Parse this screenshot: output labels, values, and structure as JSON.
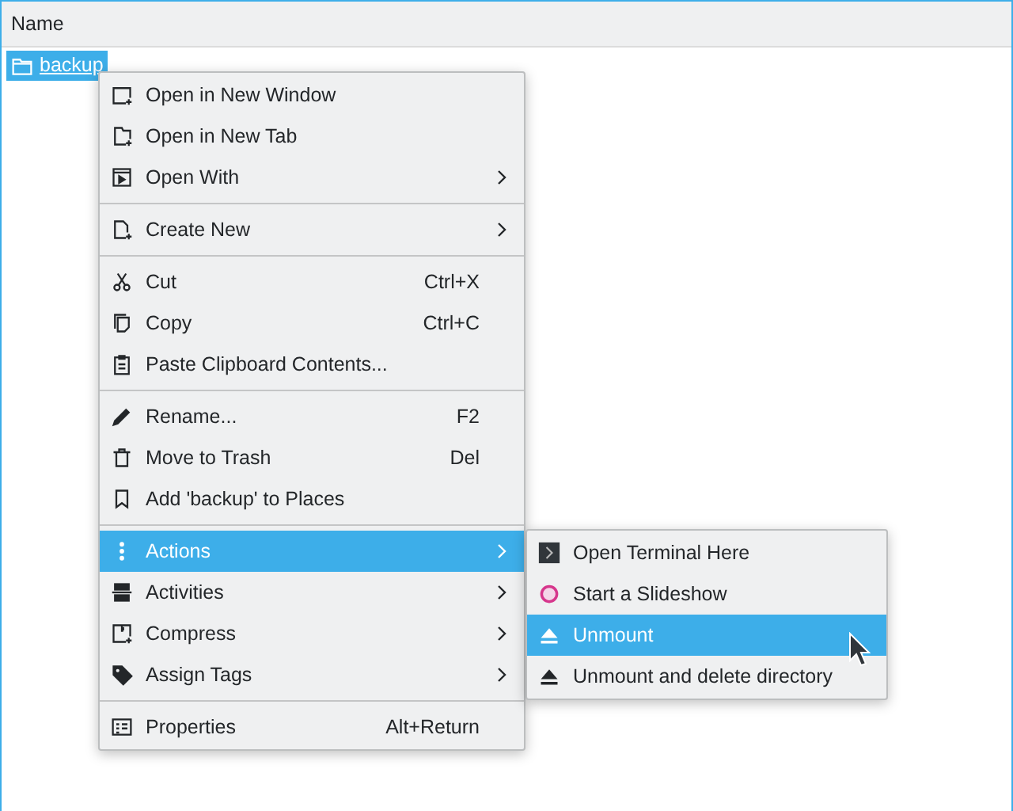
{
  "header": {
    "column": "Name"
  },
  "file": {
    "name": "backup",
    "selected": true
  },
  "menu": {
    "sections": [
      [
        {
          "label": "Open in New Window",
          "submenu": false,
          "selected": false
        },
        {
          "label": "Open in New Tab",
          "submenu": false,
          "selected": false
        },
        {
          "label": "Open With",
          "submenu": true,
          "selected": false
        }
      ],
      [
        {
          "label": "Create New",
          "submenu": true,
          "selected": false
        }
      ],
      [
        {
          "label": "Cut",
          "shortcut": "Ctrl+X",
          "submenu": false,
          "selected": false
        },
        {
          "label": "Copy",
          "shortcut": "Ctrl+C",
          "submenu": false,
          "selected": false
        },
        {
          "label": "Paste Clipboard Contents...",
          "submenu": false,
          "selected": false
        }
      ],
      [
        {
          "label": "Rename...",
          "shortcut": "F2",
          "submenu": false,
          "selected": false
        },
        {
          "label": "Move to Trash",
          "shortcut": "Del",
          "submenu": false,
          "selected": false
        },
        {
          "label": "Add 'backup' to Places",
          "submenu": false,
          "selected": false
        }
      ],
      [
        {
          "label": "Actions",
          "submenu": true,
          "selected": true
        },
        {
          "label": "Activities",
          "submenu": true,
          "selected": false
        },
        {
          "label": "Compress",
          "submenu": true,
          "selected": false
        },
        {
          "label": "Assign Tags",
          "submenu": true,
          "selected": false
        }
      ],
      [
        {
          "label": "Properties",
          "shortcut": "Alt+Return",
          "submenu": false,
          "selected": false
        }
      ]
    ]
  },
  "submenu": {
    "items": [
      {
        "label": "Open Terminal Here",
        "selected": false
      },
      {
        "label": "Start a Slideshow",
        "selected": false
      },
      {
        "label": "Unmount",
        "selected": true
      },
      {
        "label": "Unmount and delete directory",
        "selected": false
      }
    ]
  }
}
